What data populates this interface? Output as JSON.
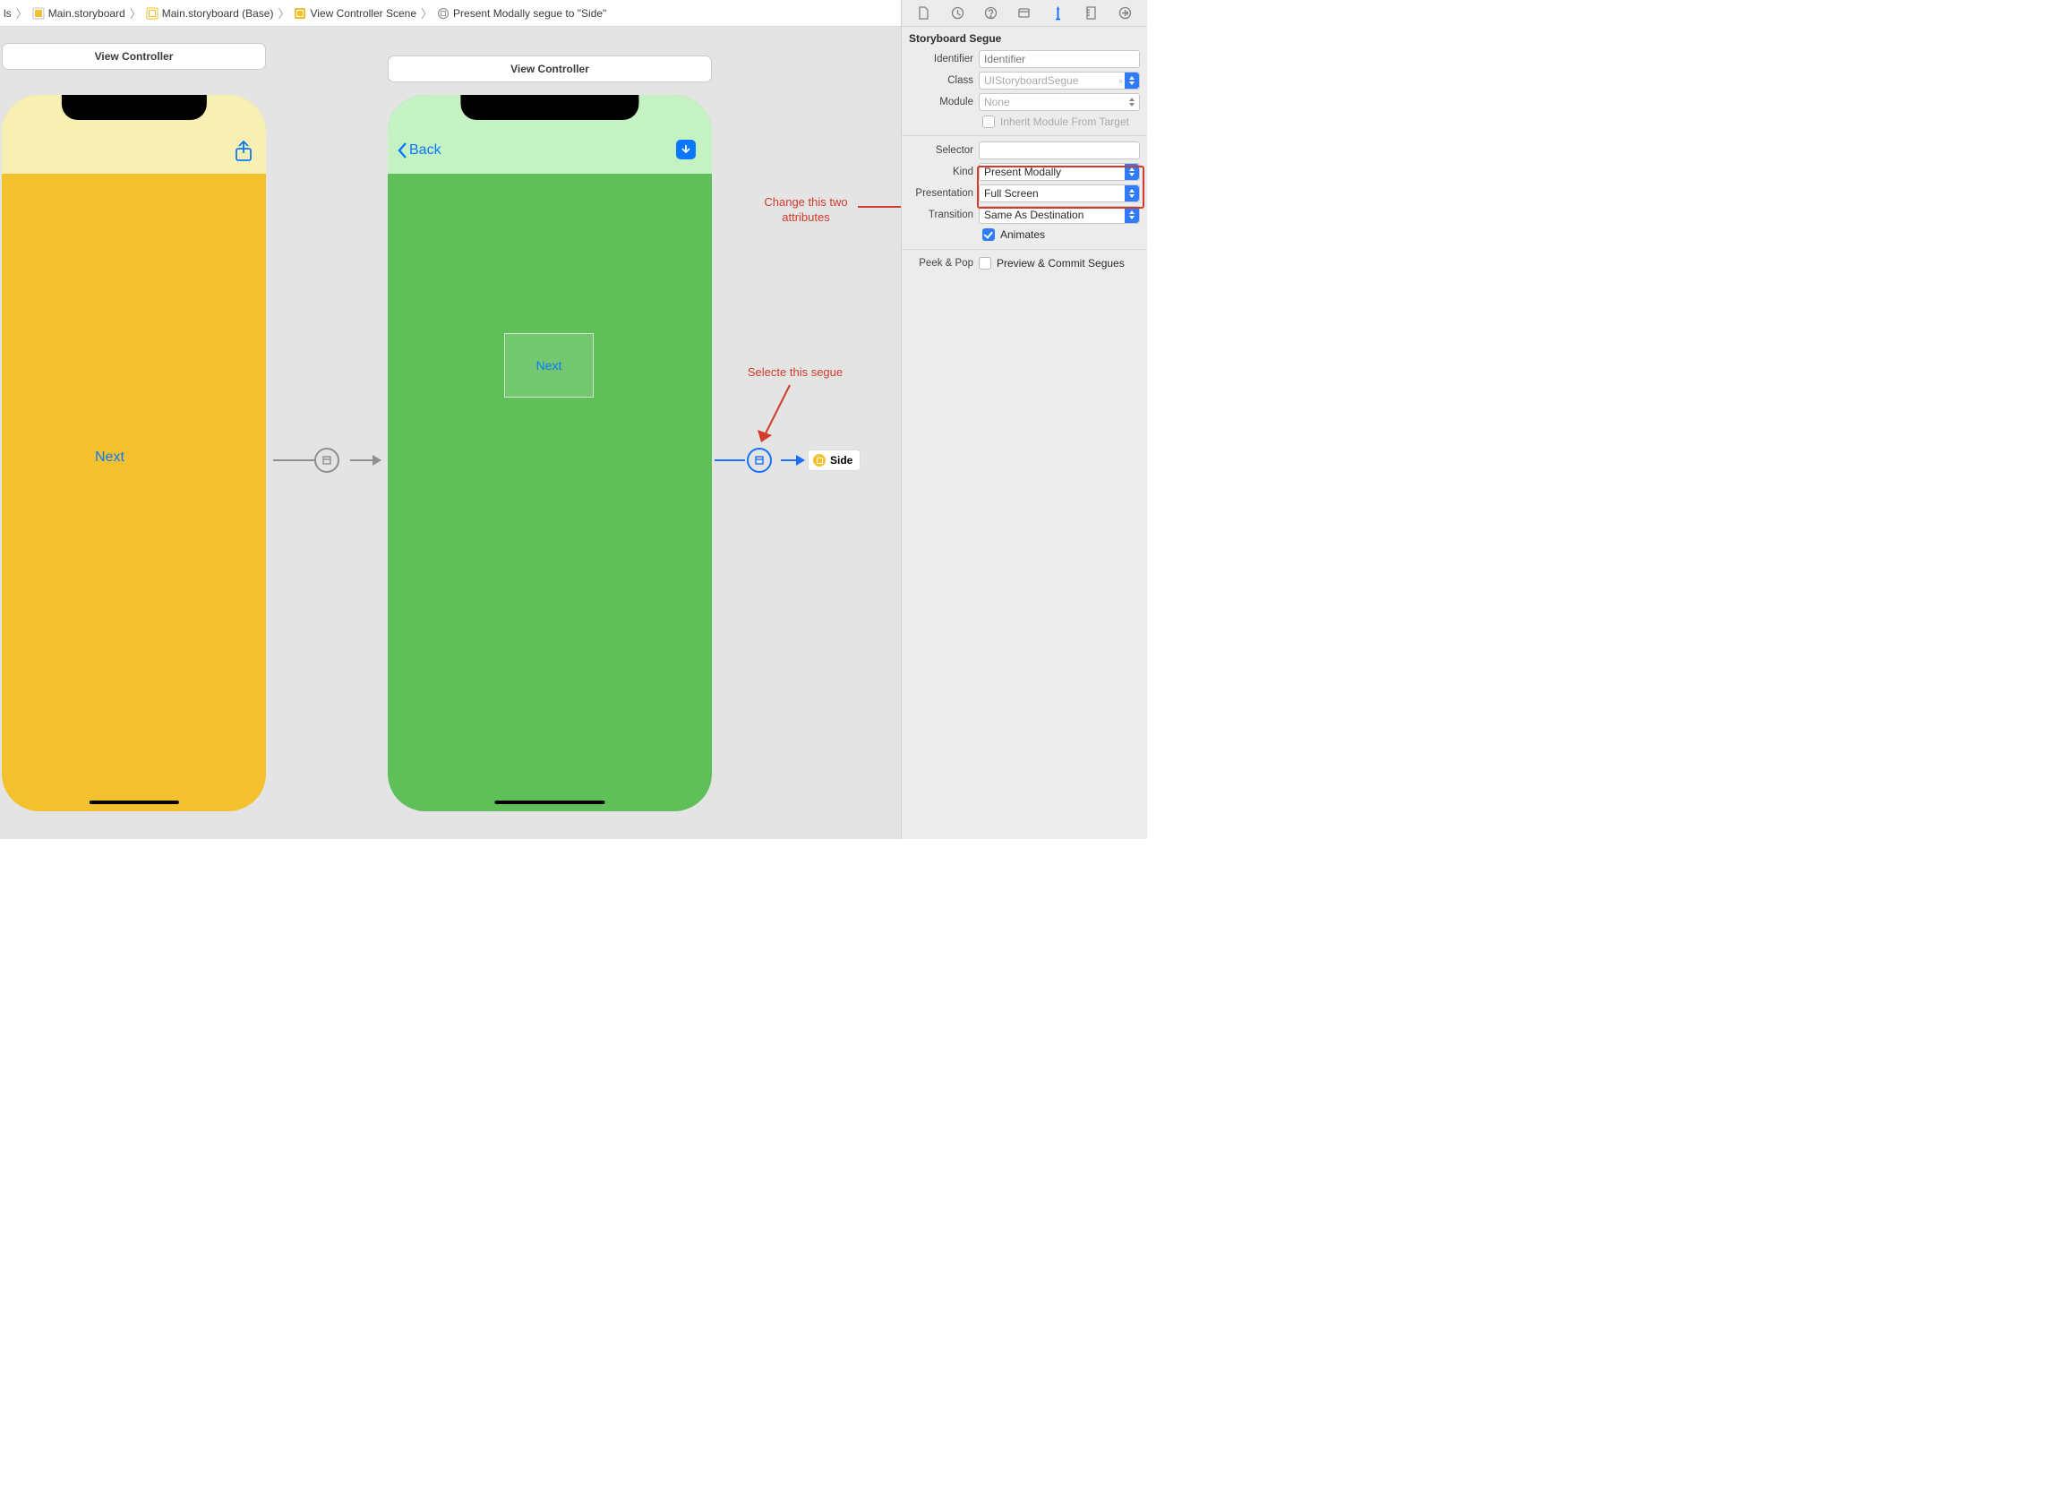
{
  "breadcrumb": {
    "item0": "ls",
    "item1": "Main.storyboard",
    "item2": "Main.storyboard (Base)",
    "item3": "View Controller Scene",
    "item4": "Present Modally segue to \"Side\""
  },
  "canvas": {
    "vc1_title": "View Controller",
    "vc2_title": "View Controller",
    "phone1": {
      "next_label": "Next"
    },
    "phone2": {
      "back_label": "Back",
      "container_label": "Next"
    },
    "side_chip": "Side"
  },
  "annotations": {
    "a1_line1": "Change this two",
    "a1_line2": "attributes",
    "a2": "Selecte this segue"
  },
  "inspector": {
    "section_title": "Storyboard Segue",
    "labels": {
      "identifier": "Identifier",
      "class": "Class",
      "module": "Module",
      "inherit": "Inherit Module From Target",
      "selector": "Selector",
      "kind": "Kind",
      "presentation": "Presentation",
      "transition": "Transition",
      "animates": "Animates",
      "peekpop": "Peek & Pop",
      "preview": "Preview & Commit Segues"
    },
    "values": {
      "identifier_placeholder": "Identifier",
      "class_placeholder": "UIStoryboardSegue",
      "module_placeholder": "None",
      "kind": "Present Modally",
      "presentation": "Full Screen",
      "transition": "Same As Destination"
    }
  }
}
